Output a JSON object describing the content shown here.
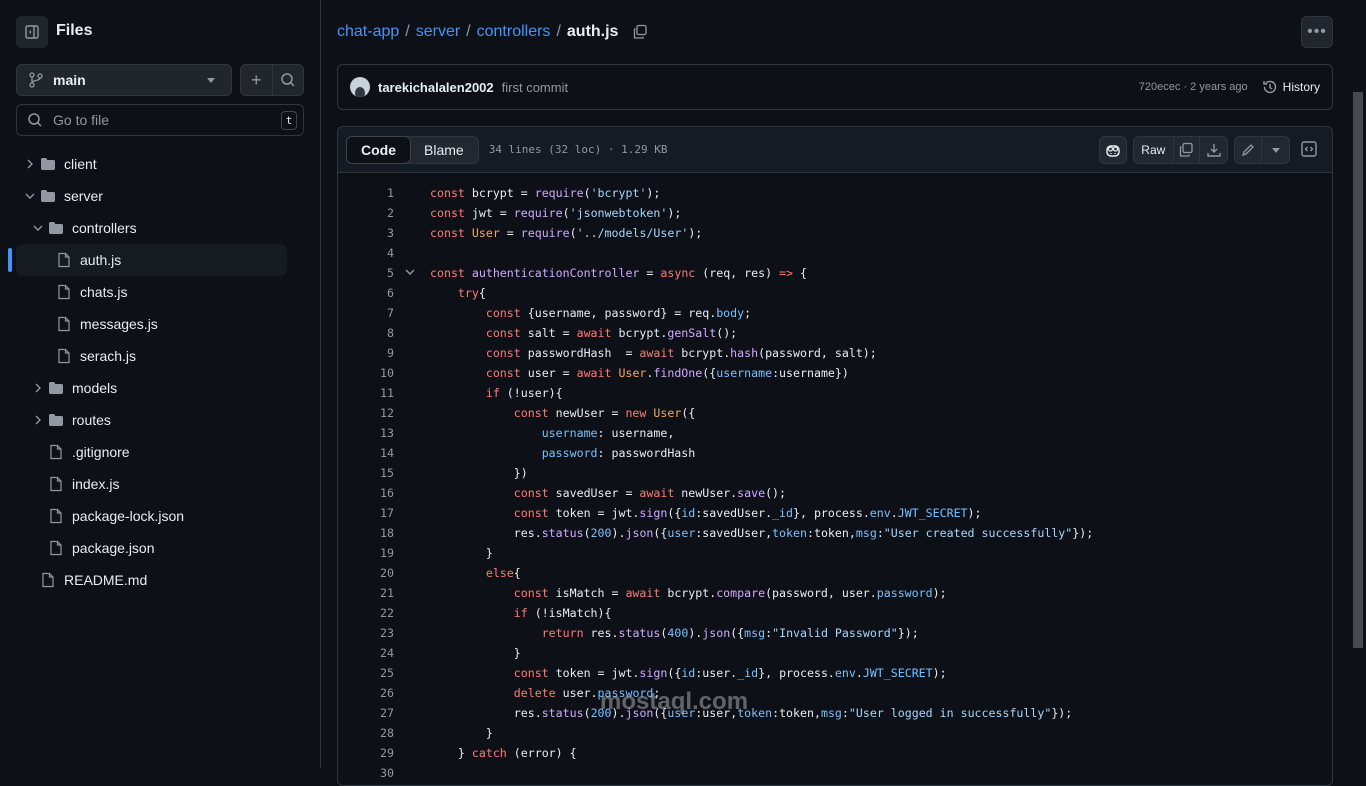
{
  "sidebar": {
    "title": "Files",
    "branch": "main",
    "goto_placeholder": "Go to file",
    "goto_shortcut": "t",
    "tree": [
      {
        "label": "client",
        "type": "folder",
        "depth": 0,
        "expanded": false
      },
      {
        "label": "server",
        "type": "folder",
        "depth": 0,
        "expanded": true
      },
      {
        "label": "controllers",
        "type": "folder",
        "depth": 1,
        "expanded": true
      },
      {
        "label": "auth.js",
        "type": "file",
        "depth": 2,
        "active": true
      },
      {
        "label": "chats.js",
        "type": "file",
        "depth": 2
      },
      {
        "label": "messages.js",
        "type": "file",
        "depth": 2
      },
      {
        "label": "serach.js",
        "type": "file",
        "depth": 2
      },
      {
        "label": "models",
        "type": "folder",
        "depth": 1,
        "expanded": false
      },
      {
        "label": "routes",
        "type": "folder",
        "depth": 1,
        "expanded": false
      },
      {
        "label": ".gitignore",
        "type": "file",
        "depth": 1
      },
      {
        "label": "index.js",
        "type": "file",
        "depth": 1
      },
      {
        "label": "package-lock.json",
        "type": "file",
        "depth": 1
      },
      {
        "label": "package.json",
        "type": "file",
        "depth": 1
      },
      {
        "label": "README.md",
        "type": "file",
        "depth": 0
      }
    ]
  },
  "breadcrumb": {
    "parts": [
      "chat-app",
      "server",
      "controllers"
    ],
    "current": "auth.js",
    "separator": "/"
  },
  "commit": {
    "author": "tarekichalalen2002",
    "message": "first commit",
    "meta": "720ecec · 2 years ago",
    "history_label": "History"
  },
  "file": {
    "tabs": [
      "Code",
      "Blame"
    ],
    "active_tab": "Code",
    "info": "34 lines (32 loc) · 1.29 KB",
    "raw_label": "Raw",
    "lines": [
      [
        [
          "k",
          "const"
        ],
        [
          "",
          "bcrypt = "
        ],
        [
          "f",
          "require"
        ],
        [
          "",
          "("
        ],
        [
          "s",
          "'bcrypt'"
        ],
        [
          "",
          ");"
        ]
      ],
      [
        [
          "k",
          "const"
        ],
        [
          "",
          "jwt = "
        ],
        [
          "f",
          "require"
        ],
        [
          "",
          "("
        ],
        [
          "s",
          "'jsonwebtoken'"
        ],
        [
          "",
          ");"
        ]
      ],
      [
        [
          "k",
          "const"
        ],
        [
          "c",
          "User"
        ],
        [
          "",
          " = "
        ],
        [
          "f",
          "require"
        ],
        [
          "",
          "("
        ],
        [
          "s",
          "'../models/User'"
        ],
        [
          "",
          ");"
        ]
      ],
      [],
      [
        [
          "k",
          "const"
        ],
        [
          "f",
          "authenticationController"
        ],
        [
          "",
          " = "
        ],
        [
          "k",
          "async"
        ],
        [
          "",
          " (req, res) "
        ],
        [
          "k",
          "=>"
        ],
        [
          "",
          " {"
        ]
      ],
      [
        [
          "",
          "    "
        ],
        [
          "k",
          "try"
        ],
        [
          "",
          "{"
        ]
      ],
      [
        [
          "",
          "        "
        ],
        [
          "k",
          "const"
        ],
        [
          "",
          " {username, password} = req."
        ],
        [
          "p",
          "body"
        ],
        [
          "",
          ";"
        ]
      ],
      [
        [
          "",
          "        "
        ],
        [
          "k",
          "const"
        ],
        [
          "",
          " salt = "
        ],
        [
          "k",
          "await"
        ],
        [
          "",
          " bcrypt."
        ],
        [
          "f",
          "genSalt"
        ],
        [
          "",
          "();"
        ]
      ],
      [
        [
          "",
          "        "
        ],
        [
          "k",
          "const"
        ],
        [
          "",
          " passwordHash  = "
        ],
        [
          "k",
          "await"
        ],
        [
          "",
          " bcrypt."
        ],
        [
          "f",
          "hash"
        ],
        [
          "",
          "(password, salt);"
        ]
      ],
      [
        [
          "",
          "        "
        ],
        [
          "k",
          "const"
        ],
        [
          "",
          " user = "
        ],
        [
          "k",
          "await"
        ],
        [
          " ",
          ""
        ],
        [
          "c",
          "User"
        ],
        [
          "",
          "."
        ],
        [
          "f",
          "findOne"
        ],
        [
          "",
          "({"
        ],
        [
          "p",
          "username"
        ],
        [
          "",
          ":username})"
        ]
      ],
      [
        [
          "",
          "        "
        ],
        [
          "k",
          "if"
        ],
        [
          "",
          " (!user){"
        ]
      ],
      [
        [
          "",
          "            "
        ],
        [
          "k",
          "const"
        ],
        [
          "",
          " newUser = "
        ],
        [
          "k",
          "new"
        ],
        [
          "",
          " "
        ],
        [
          "c",
          "User"
        ],
        [
          "",
          "({"
        ]
      ],
      [
        [
          "",
          "                "
        ],
        [
          "p",
          "username"
        ],
        [
          "",
          ": username,"
        ]
      ],
      [
        [
          "",
          "                "
        ],
        [
          "p",
          "password"
        ],
        [
          "",
          ": passwordHash"
        ]
      ],
      [
        [
          "",
          "            })"
        ]
      ],
      [
        [
          "",
          "            "
        ],
        [
          "k",
          "const"
        ],
        [
          "",
          " savedUser = "
        ],
        [
          "k",
          "await"
        ],
        [
          "",
          " newUser."
        ],
        [
          "f",
          "save"
        ],
        [
          "",
          "();"
        ]
      ],
      [
        [
          "",
          "            "
        ],
        [
          "k",
          "const"
        ],
        [
          "",
          " token = jwt."
        ],
        [
          "f",
          "sign"
        ],
        [
          "",
          "({"
        ],
        [
          "p",
          "id"
        ],
        [
          "",
          ":savedUser."
        ],
        [
          "p",
          "_id"
        ],
        [
          "",
          "}, process."
        ],
        [
          "p",
          "env"
        ],
        [
          "",
          "."
        ],
        [
          "p",
          "JWT_SECRET"
        ],
        [
          "",
          ");"
        ]
      ],
      [
        [
          "",
          "            res."
        ],
        [
          "f",
          "status"
        ],
        [
          "",
          "("
        ],
        [
          "p",
          "200"
        ],
        [
          "",
          ")."
        ],
        [
          "f",
          "json"
        ],
        [
          "",
          "({"
        ],
        [
          "p",
          "user"
        ],
        [
          "",
          ":savedUser,"
        ],
        [
          "p",
          "token"
        ],
        [
          "",
          ":token,"
        ],
        [
          "p",
          "msg"
        ],
        [
          "",
          ":"
        ],
        [
          "s",
          "\"User created successfully\""
        ],
        [
          "",
          "});"
        ]
      ],
      [
        [
          "",
          "        }"
        ]
      ],
      [
        [
          "",
          "        "
        ],
        [
          "k",
          "else"
        ],
        [
          "",
          "{"
        ]
      ],
      [
        [
          "",
          "            "
        ],
        [
          "k",
          "const"
        ],
        [
          "",
          " isMatch = "
        ],
        [
          "k",
          "await"
        ],
        [
          "",
          " bcrypt."
        ],
        [
          "f",
          "compare"
        ],
        [
          "",
          "(password, user."
        ],
        [
          "p",
          "password"
        ],
        [
          "",
          ");"
        ]
      ],
      [
        [
          "",
          "            "
        ],
        [
          "k",
          "if"
        ],
        [
          "",
          " (!isMatch){"
        ]
      ],
      [
        [
          "",
          "                "
        ],
        [
          "k",
          "return"
        ],
        [
          "",
          " res."
        ],
        [
          "f",
          "status"
        ],
        [
          "",
          "("
        ],
        [
          "p",
          "400"
        ],
        [
          "",
          ")."
        ],
        [
          "f",
          "json"
        ],
        [
          "",
          "({"
        ],
        [
          "p",
          "msg"
        ],
        [
          "",
          ":"
        ],
        [
          "s",
          "\"Invalid Password\""
        ],
        [
          "",
          "});"
        ]
      ],
      [
        [
          "",
          "            }"
        ]
      ],
      [
        [
          "",
          "            "
        ],
        [
          "k",
          "const"
        ],
        [
          "",
          " token = jwt."
        ],
        [
          "f",
          "sign"
        ],
        [
          "",
          "({"
        ],
        [
          "p",
          "id"
        ],
        [
          "",
          ":user."
        ],
        [
          "p",
          "_id"
        ],
        [
          "",
          "}, process."
        ],
        [
          "p",
          "env"
        ],
        [
          "",
          "."
        ],
        [
          "p",
          "JWT_SECRET"
        ],
        [
          "",
          ");"
        ]
      ],
      [
        [
          "",
          "            "
        ],
        [
          "k",
          "delete"
        ],
        [
          "",
          " user."
        ],
        [
          "p",
          "password"
        ],
        [
          "",
          ";"
        ]
      ],
      [
        [
          "",
          "            res."
        ],
        [
          "f",
          "status"
        ],
        [
          "",
          "("
        ],
        [
          "p",
          "200"
        ],
        [
          "",
          ")."
        ],
        [
          "f",
          "json"
        ],
        [
          "",
          "({"
        ],
        [
          "p",
          "user"
        ],
        [
          "",
          ":user,"
        ],
        [
          "p",
          "token"
        ],
        [
          "",
          ":token,"
        ],
        [
          "p",
          "msg"
        ],
        [
          "",
          ":"
        ],
        [
          "s",
          "\"User logged in successfully\""
        ],
        [
          "",
          "});"
        ]
      ],
      [
        [
          "",
          "        }"
        ]
      ],
      [
        [
          "",
          "    } "
        ],
        [
          "k",
          "catch"
        ],
        [
          "",
          " (error) {"
        ]
      ],
      []
    ]
  },
  "watermark": "mostaql.com",
  "colors": {
    "background": "#0d1117",
    "accent": "#4493f8",
    "keyword": "#ff7b72",
    "function": "#d2a8ff",
    "string": "#a5d6ff",
    "property": "#79c0ff",
    "class": "#ffa657"
  }
}
